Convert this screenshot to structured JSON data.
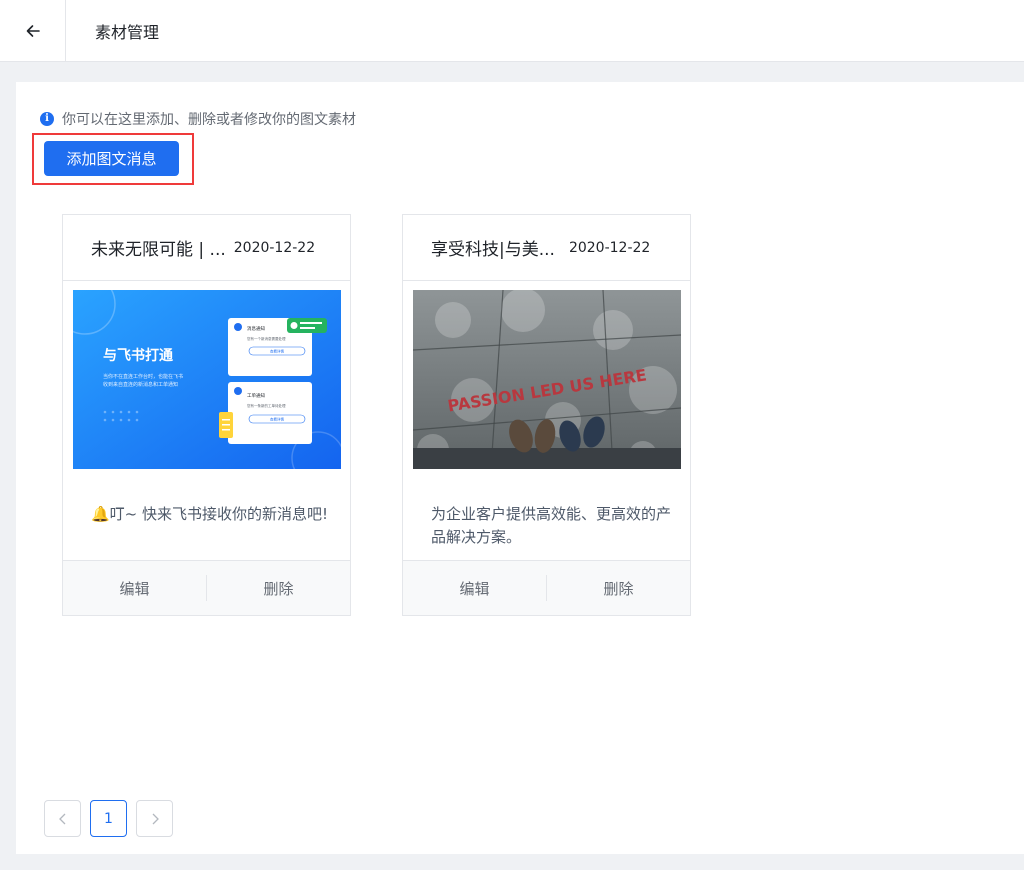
{
  "header": {
    "title": "素材管理",
    "back_icon": "arrow-left-icon"
  },
  "tip": {
    "icon": "info-icon",
    "text": "你可以在这里添加、删除或者修改你的图文素材"
  },
  "toolbar": {
    "add_label": "添加图文消息"
  },
  "cards": [
    {
      "title": "未来无限可能 | ...",
      "date": "2020-12-22",
      "image": {
        "heading": "与飞书打通",
        "sub_line1": "当你不在直连工作台时，也能在飞书",
        "sub_line2": "收到来自直连的新消息和工单通知",
        "notice1_title": "消息通知",
        "notice1_line": "您有一个新消息需要处理",
        "notice1_btn": "查看详情",
        "notice2_title": "工单通知",
        "notice2_line": "您有一条新的工单待处理",
        "notice2_btn": "查看详情"
      },
      "desc": "🔔叮~ 快来飞书接收你的新消息吧!",
      "edit_label": "编辑",
      "delete_label": "删除"
    },
    {
      "title": "享受科技|与美...",
      "date": "2020-12-22",
      "image": {
        "caption": "PASSION LED US HERE"
      },
      "desc": "为企业客户提供高效能、更高效的产品解决方案。",
      "edit_label": "编辑",
      "delete_label": "删除"
    }
  ],
  "pagination": {
    "prev_icon": "chevron-left-icon",
    "current_page": "1",
    "next_icon": "chevron-right-icon"
  },
  "colors": {
    "accent": "#1f6ef0",
    "highlight_border": "#ef3a3a",
    "background": "#eff1f4"
  }
}
